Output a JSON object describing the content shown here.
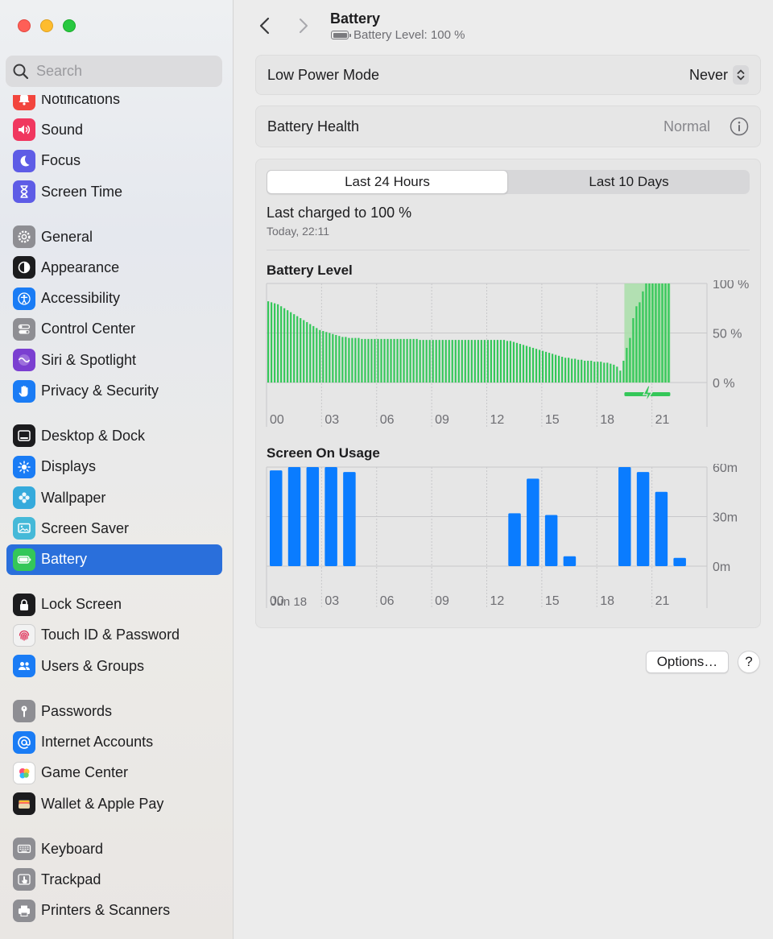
{
  "search": {
    "placeholder": "Search"
  },
  "sidebar": {
    "items": [
      {
        "label": "Notifications",
        "icon": "bell-icon",
        "color": "#f2453d",
        "gap": false
      },
      {
        "label": "Sound",
        "icon": "speaker-icon",
        "color": "#f0375f",
        "gap": false
      },
      {
        "label": "Focus",
        "icon": "moon-icon",
        "color": "#5e5ce6",
        "gap": false
      },
      {
        "label": "Screen Time",
        "icon": "hourglass-icon",
        "color": "#5e5ce6",
        "gap": false
      },
      {
        "label": "General",
        "icon": "gear-icon",
        "color": "#8e8e93",
        "gap": true
      },
      {
        "label": "Appearance",
        "icon": "appearance-icon",
        "color": "#1c1c1e",
        "gap": false
      },
      {
        "label": "Accessibility",
        "icon": "accessibility-icon",
        "color": "#1a7cf5",
        "gap": false
      },
      {
        "label": "Control Center",
        "icon": "toggles-icon",
        "color": "#8e8e93",
        "gap": false
      },
      {
        "label": "Siri & Spotlight",
        "icon": "siri-icon",
        "color": "#7b3fd1",
        "gap": false
      },
      {
        "label": "Privacy & Security",
        "icon": "hand-icon",
        "color": "#1a7cf5",
        "gap": false
      },
      {
        "label": "Desktop & Dock",
        "icon": "dock-icon",
        "color": "#1c1c1e",
        "gap": true
      },
      {
        "label": "Displays",
        "icon": "sun-icon",
        "color": "#1a7cf5",
        "gap": false
      },
      {
        "label": "Wallpaper",
        "icon": "flower-icon",
        "color": "#35aadc",
        "gap": false
      },
      {
        "label": "Screen Saver",
        "icon": "screensaver-icon",
        "color": "#45b9d8",
        "gap": false
      },
      {
        "label": "Battery",
        "icon": "battery-icon",
        "color": "#34c759",
        "gap": false,
        "selected": true
      },
      {
        "label": "Lock Screen",
        "icon": "lock-icon",
        "color": "#1c1c1e",
        "gap": true
      },
      {
        "label": "Touch ID & Password",
        "icon": "fingerprint-icon",
        "color": "#f2f2f2",
        "gap": false
      },
      {
        "label": "Users & Groups",
        "icon": "users-icon",
        "color": "#1a7cf5",
        "gap": false
      },
      {
        "label": "Passwords",
        "icon": "key-icon",
        "color": "#8e8e93",
        "gap": true
      },
      {
        "label": "Internet Accounts",
        "icon": "at-icon",
        "color": "#1a7cf5",
        "gap": false
      },
      {
        "label": "Game Center",
        "icon": "game-center-icon",
        "color": "#ffffff",
        "gap": false
      },
      {
        "label": "Wallet & Apple Pay",
        "icon": "wallet-icon",
        "color": "#1c1c1e",
        "gap": false
      },
      {
        "label": "Keyboard",
        "icon": "keyboard-icon",
        "color": "#8e8e93",
        "gap": true
      },
      {
        "label": "Trackpad",
        "icon": "trackpad-icon",
        "color": "#8e8e93",
        "gap": false
      },
      {
        "label": "Printers & Scanners",
        "icon": "printer-icon",
        "color": "#8e8e93",
        "gap": false
      }
    ]
  },
  "header": {
    "title": "Battery",
    "subtitle": "Battery Level: 100 %"
  },
  "low_power": {
    "label": "Low Power Mode",
    "value": "Never"
  },
  "health": {
    "label": "Battery Health",
    "value": "Normal"
  },
  "usage": {
    "tabs": [
      {
        "label": "Last 24 Hours",
        "active": true
      },
      {
        "label": "Last 10 Days",
        "active": false
      }
    ],
    "last_charged": "Last charged to 100 %",
    "last_charged_time": "Today, 22:11",
    "date": "Jun 18"
  },
  "colors": {
    "accent": "#2a6fdb",
    "battery_green": "#34c759",
    "usage_blue": "#0a7cff",
    "charging_band": "#a8dea8"
  },
  "chart_data": [
    {
      "type": "bar",
      "title": "Battery Level",
      "xlabel": "",
      "ylabel": "",
      "x_ticks": [
        "00",
        "03",
        "06",
        "09",
        "12",
        "15",
        "18",
        "21"
      ],
      "y_ticks": [
        "100 %",
        "50 %",
        "0 %"
      ],
      "ylim": [
        0,
        100
      ],
      "charging_window_hours": [
        19.5,
        22
      ],
      "values": [
        82,
        81,
        80,
        79,
        77,
        75,
        73,
        71,
        69,
        67,
        65,
        63,
        61,
        59,
        57,
        55,
        53,
        52,
        51,
        50,
        49,
        48,
        47,
        46,
        46,
        45,
        45,
        45,
        45,
        44,
        44,
        44,
        44,
        44,
        44,
        44,
        44,
        44,
        44,
        44,
        44,
        44,
        44,
        44,
        44,
        44,
        44,
        43,
        43,
        43,
        43,
        43,
        43,
        43,
        43,
        43,
        43,
        43,
        43,
        43,
        43,
        43,
        43,
        43,
        43,
        43,
        43,
        43,
        43,
        43,
        43,
        43,
        43,
        43,
        42,
        42,
        41,
        40,
        39,
        38,
        37,
        36,
        35,
        34,
        33,
        32,
        31,
        30,
        29,
        28,
        27,
        26,
        25,
        25,
        24,
        24,
        23,
        23,
        22,
        22,
        22,
        21,
        21,
        21,
        20,
        20,
        19,
        18,
        16,
        12,
        22,
        35,
        45,
        65,
        77,
        81,
        92,
        100,
        100,
        100,
        100,
        100,
        100,
        100,
        100
      ]
    },
    {
      "type": "bar",
      "title": "Screen On Usage",
      "xlabel": "",
      "ylabel": "",
      "x_ticks": [
        "00",
        "03",
        "06",
        "09",
        "12",
        "15",
        "18",
        "21"
      ],
      "y_ticks": [
        "60m",
        "30m",
        "0m"
      ],
      "ylim": [
        0,
        60
      ],
      "hours": [
        0,
        1,
        2,
        3,
        4,
        5,
        6,
        7,
        8,
        9,
        10,
        11,
        12,
        13,
        14,
        15,
        16,
        17,
        18,
        19,
        20,
        21,
        22,
        23
      ],
      "values": [
        58,
        60,
        60,
        60,
        57,
        0,
        0,
        0,
        0,
        0,
        0,
        0,
        0,
        32,
        53,
        31,
        6,
        0,
        0,
        60,
        57,
        45,
        5,
        0
      ]
    }
  ]
}
